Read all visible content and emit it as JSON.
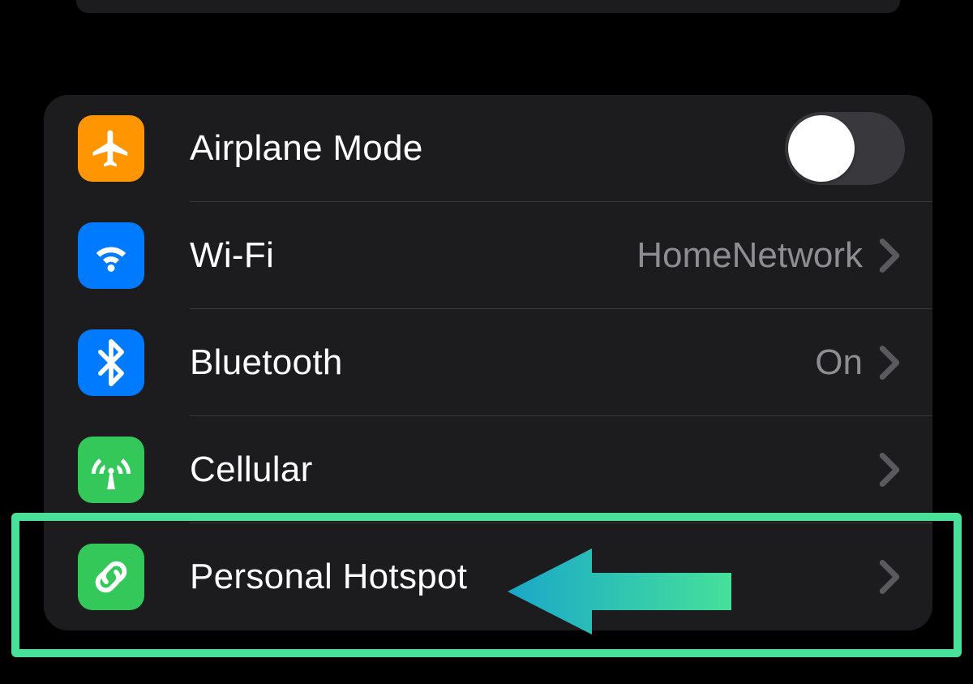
{
  "rows": {
    "airplane": {
      "label": "Airplane Mode",
      "toggle_on": false
    },
    "wifi": {
      "label": "Wi-Fi",
      "value": "HomeNetwork"
    },
    "bluetooth": {
      "label": "Bluetooth",
      "value": "On"
    },
    "cellular": {
      "label": "Cellular"
    },
    "hotspot": {
      "label": "Personal Hotspot"
    }
  },
  "colors": {
    "highlight": "#49e19a"
  }
}
